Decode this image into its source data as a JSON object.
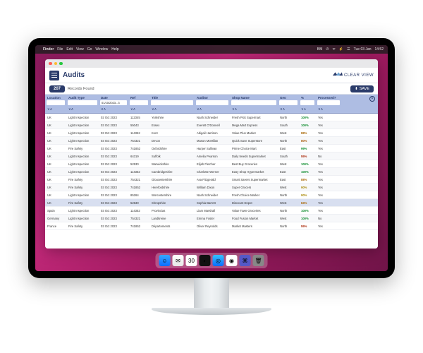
{
  "menubar": {
    "apple": "",
    "app": "Finder",
    "items": [
      "File",
      "Edit",
      "View",
      "Go",
      "Window",
      "Help"
    ],
    "right": [
      "BM",
      "⏻",
      "ᯤ",
      "⚡",
      "☰",
      "Tue 03 Jan",
      "14:52"
    ]
  },
  "window": {
    "title": "Audits",
    "logo_text": "CLEAR VIEW",
    "record_count": "207",
    "records_label": "Records Found",
    "save_label": "SAVE"
  },
  "columns": [
    "Location",
    "Audit Type",
    "Date",
    "Ref",
    "Title",
    "Auditor",
    "Shop Name",
    "Geo",
    "%",
    "Processed?"
  ],
  "filter_date": "01/10/2023...3",
  "sort_mark": "∨∧",
  "rows": [
    {
      "loc": "UK",
      "type": "Light Inspection",
      "date": "02 Oct 2023",
      "ref": "112345",
      "title": "Yorkshire",
      "aud": "Noah Schneider",
      "shop": "Fresh Pick Supermart",
      "geo": "North",
      "pct": "100%",
      "cls": "g100",
      "proc": "Yes"
    },
    {
      "loc": "UK",
      "type": "Light Inspection",
      "date": "03 Oct 2023",
      "ref": "55043",
      "title": "Essex",
      "aud": "Everett O'Donnell",
      "shop": "Mega Mart Express",
      "geo": "South",
      "pct": "100%",
      "cls": "g100",
      "proc": "Yes"
    },
    {
      "loc": "UK",
      "type": "Light Inspection",
      "date": "03 Oct 2023",
      "ref": "114352",
      "title": "Kent",
      "aud": "Abigail Harrison",
      "shop": "Value Plus Market",
      "geo": "West",
      "pct": "88%",
      "cls": "g88",
      "proc": "Yes"
    },
    {
      "loc": "UK",
      "type": "Light Inspection",
      "date": "03 Oct 2023",
      "ref": "754321",
      "title": "Devon",
      "aud": "Mason McMillan",
      "shop": "Quick Save Superstore",
      "geo": "North",
      "pct": "80%",
      "cls": "g80",
      "proc": "Yes"
    },
    {
      "loc": "UK",
      "type": "Fire Safety",
      "date": "03 Oct 2023",
      "ref": "741852",
      "title": "Oxfordshire",
      "aud": "Harper Sullivan",
      "shop": "Prime Choice Mart",
      "geo": "East",
      "pct": "99%",
      "cls": "g99",
      "proc": "Yes"
    },
    {
      "loc": "UK",
      "type": "Light Inspection",
      "date": "03 Oct 2023",
      "ref": "64319",
      "title": "Suffolk",
      "aud": "Amelia Pearson",
      "shop": "Daily Needs Supermarket",
      "geo": "South",
      "pct": "55%",
      "cls": "g55",
      "proc": "No"
    },
    {
      "loc": "UK",
      "type": "Light Inspection",
      "date": "03 Oct 2023",
      "ref": "52530",
      "title": "Warwickshire",
      "aud": "Elijah Fletcher",
      "shop": "Best Buy Groceries",
      "geo": "West",
      "pct": "100%",
      "cls": "g100",
      "proc": "Yes"
    },
    {
      "loc": "UK",
      "type": "Light Inspection",
      "date": "03 Oct 2023",
      "ref": "114352",
      "title": "Cambridgeshire",
      "aud": "Charlotte Werner",
      "shop": "Easy Shop Hypermarket",
      "geo": "East",
      "pct": "100%",
      "cls": "g100",
      "proc": "Yes"
    },
    {
      "loc": "UK",
      "type": "Fire Safety",
      "date": "03 Oct 2023",
      "ref": "754321",
      "title": "Gloucestershire",
      "aud": "Ava Fitzgerald",
      "shop": "Smart Savers Supermarket",
      "geo": "East",
      "pct": "88%",
      "cls": "g88",
      "proc": "Yes"
    },
    {
      "loc": "UK",
      "type": "Fire Safety",
      "date": "03 Oct 2023",
      "ref": "741852",
      "title": "Herefordshire",
      "aud": "William Dixon",
      "shop": "Super Grocers",
      "geo": "West",
      "pct": "90%",
      "cls": "g90",
      "proc": "Yes"
    },
    {
      "loc": "UK",
      "type": "Light Inspection",
      "date": "03 Oct 2023",
      "ref": "85264",
      "title": "Worcestershire",
      "aud": "Noah Schneider",
      "shop": "Fresh Choice Market",
      "geo": "North",
      "pct": "90%",
      "cls": "g90",
      "proc": "Yes"
    },
    {
      "loc": "UK",
      "type": "Fire Safety",
      "date": "03 Oct 2023",
      "ref": "52530",
      "title": "Shropshire",
      "aud": "Sophia Barrett",
      "shop": "Discount Depot",
      "geo": "West",
      "pct": "84%",
      "cls": "g84",
      "proc": "Yes"
    },
    {
      "loc": "Spain",
      "type": "Light Inspection",
      "date": "03 Oct 2023",
      "ref": "114352",
      "title": "Provincias",
      "aud": "Liam Marshall",
      "shop": "Value Town Groceries",
      "geo": "North",
      "pct": "100%",
      "cls": "g100",
      "proc": "Yes"
    },
    {
      "loc": "Germany",
      "type": "Light Inspection",
      "date": "03 Oct 2023",
      "ref": "754321",
      "title": "Landkreise",
      "aud": "Emma Foster",
      "shop": "Food Fusion Market",
      "geo": "West",
      "pct": "100%",
      "cls": "g100",
      "proc": "No"
    },
    {
      "loc": "France",
      "type": "Fire Safety",
      "date": "03 Oct 2023",
      "ref": "741852",
      "title": "Départements",
      "aud": "Oliver Reynolds",
      "shop": "Market Masters",
      "geo": "North",
      "pct": "55%",
      "cls": "g55",
      "proc": "Yes"
    }
  ],
  "dock": [
    {
      "name": "finder",
      "bg": "linear-gradient(#36a7ff,#0a6cff)",
      "glyph": "☺"
    },
    {
      "name": "mail",
      "bg": "linear-gradient(#fff,#e6e6e6)",
      "glyph": "✉"
    },
    {
      "name": "calendar",
      "bg": "#fff",
      "glyph": "30"
    },
    {
      "name": "app1",
      "bg": "#111",
      "glyph": "◐"
    },
    {
      "name": "safari",
      "bg": "linear-gradient(#35c3ff,#0a6cff)",
      "glyph": "◎"
    },
    {
      "name": "chrome",
      "bg": "#fff",
      "glyph": "◉"
    },
    {
      "name": "teams",
      "bg": "#5558c7",
      "glyph": "⌘"
    },
    {
      "name": "trash",
      "bg": "#888",
      "glyph": "🗑"
    }
  ]
}
